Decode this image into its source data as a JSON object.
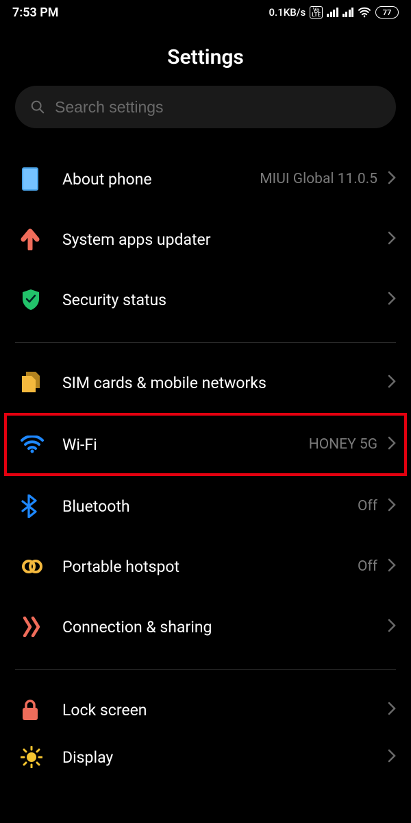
{
  "status": {
    "time": "7:53 PM",
    "net_speed": "0.1KB/s",
    "battery": "77"
  },
  "title": "Settings",
  "search": {
    "placeholder": "Search settings"
  },
  "rows": {
    "about": {
      "label": "About phone",
      "value": "MIUI Global 11.0.5"
    },
    "updater": {
      "label": "System apps updater",
      "value": ""
    },
    "security": {
      "label": "Security status",
      "value": ""
    },
    "sim": {
      "label": "SIM cards & mobile networks",
      "value": ""
    },
    "wifi": {
      "label": "Wi-Fi",
      "value": "HONEY 5G"
    },
    "bt": {
      "label": "Bluetooth",
      "value": "Off"
    },
    "hotspot": {
      "label": "Portable hotspot",
      "value": "Off"
    },
    "connshare": {
      "label": "Connection & sharing",
      "value": ""
    },
    "lock": {
      "label": "Lock screen",
      "value": ""
    },
    "display": {
      "label": "Display",
      "value": ""
    }
  },
  "colors": {
    "accent_blue": "#1e88ff",
    "green": "#22c36a",
    "coral": "#ef6c5a",
    "amber": "#f4b93e",
    "red": "#e3000f"
  }
}
